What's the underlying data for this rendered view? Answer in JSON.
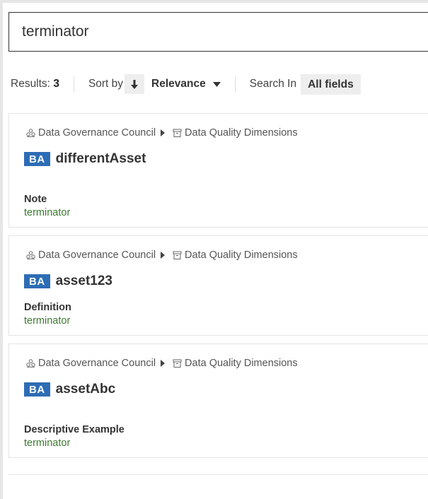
{
  "search": {
    "value": "terminator"
  },
  "toolbar": {
    "results_label": "Results:",
    "results_count": "3",
    "sort_by_label": "Sort by",
    "sort_value": "Relevance",
    "search_in_label": "Search In",
    "search_in_value": "All fields"
  },
  "results": [
    {
      "community": "Data Governance Council",
      "domain": "Data Quality Dimensions",
      "type": "BA",
      "name": "differentAsset",
      "attribute_name": "Note",
      "attribute_value": "terminator"
    },
    {
      "community": "Data Governance Council",
      "domain": "Data Quality Dimensions",
      "type": "BA",
      "name": "asset123",
      "attribute_name": "Definition",
      "attribute_value": "terminator"
    },
    {
      "community": "Data Governance Council",
      "domain": "Data Quality Dimensions",
      "type": "BA",
      "name": "assetAbc",
      "attribute_name": "Descriptive Example",
      "attribute_value": "terminator"
    }
  ],
  "colors": {
    "badge": "#2d6db5",
    "match_value": "#3b7a2e"
  }
}
